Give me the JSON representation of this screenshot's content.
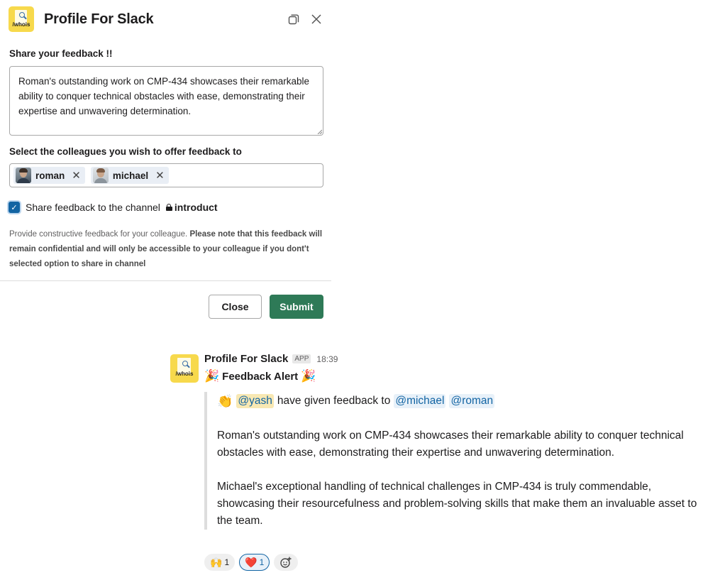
{
  "modal": {
    "title": "Profile For Slack",
    "logo_text": "/whois",
    "feedback_label": "Share your feedback !!",
    "feedback_value": "Roman's outstanding work on CMP-434 showcases their remarkable ability to conquer technical obstacles with ease, demonstrating their expertise and unwavering determination.",
    "colleagues_label": "Select the colleagues you wish to offer feedback to",
    "colleagues": [
      {
        "name": "roman"
      },
      {
        "name": "michael"
      }
    ],
    "share_checkbox": {
      "checked": true,
      "label": "Share feedback to the channel",
      "channel": "introduct"
    },
    "help_text_normal": "Provide constructive feedback for your colleague.",
    "help_text_bold": "Please note that this feedback will remain confidential and will only be accessible to your colleague if you dont't selected option to share in channel",
    "close_label": "Close",
    "submit_label": "Submit",
    "colors": {
      "submit": "#2e7a57",
      "checkbox": "#1264a3"
    }
  },
  "message": {
    "sender": "Profile For Slack",
    "badge": "APP",
    "time": "18:39",
    "logo_text": "/whois",
    "alert_title": "Feedback Alert",
    "from_mention": "@yash",
    "given_text": "have given feedback to",
    "to_mentions": [
      "@michael",
      "@roman"
    ],
    "paragraph_1": "Roman's outstanding work on CMP-434 showcases their remarkable ability to conquer technical obstacles with ease, demonstrating their expertise and unwavering determination.",
    "paragraph_2": "Michael's exceptional handling of technical challenges in CMP-434 is truly commendable, showcasing their resourcefulness and problem-solving skills that make them an invaluable asset to the team.",
    "reactions": [
      {
        "emoji": "🙌",
        "count": "1",
        "active": false
      },
      {
        "emoji": "❤️",
        "count": "1",
        "active": true
      }
    ]
  }
}
